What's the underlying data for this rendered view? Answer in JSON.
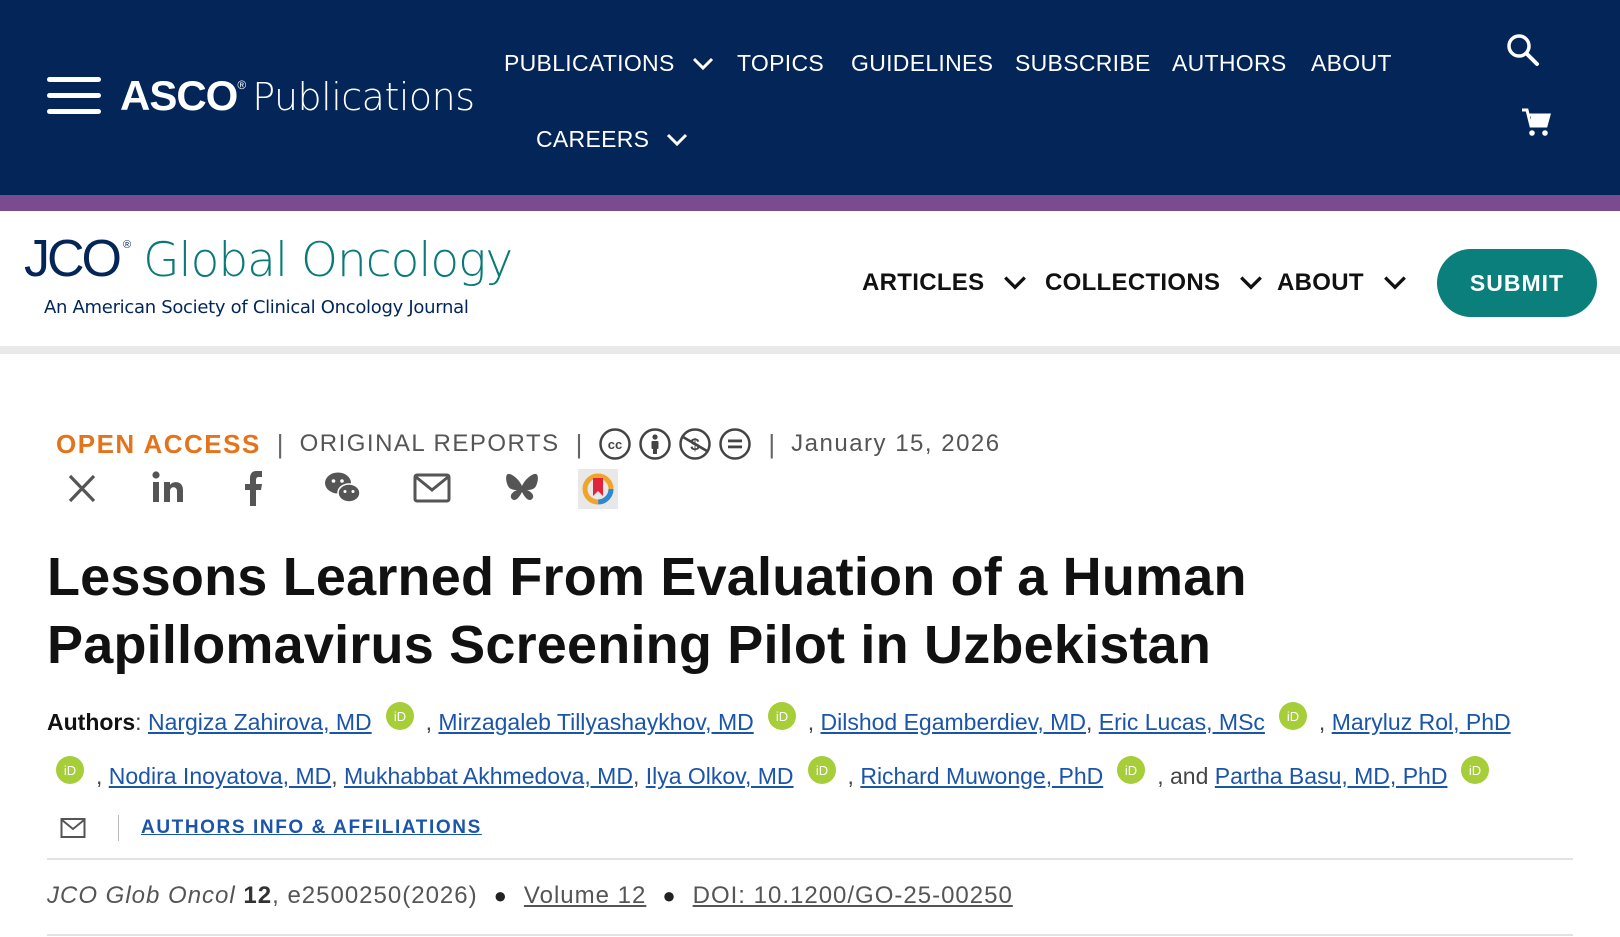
{
  "topbar": {
    "brand_asco": "ASCO",
    "brand_reg": "®",
    "brand_publications": "Publications",
    "nav": [
      "PUBLICATIONS",
      "TOPICS",
      "GUIDELINES",
      "SUBSCRIBE",
      "AUTHORS",
      "ABOUT",
      "CAREERS"
    ],
    "icons": [
      "menu-icon",
      "search-icon",
      "cart-icon",
      "chevron-down-icon"
    ]
  },
  "journal_header": {
    "logo_jco": "JCO",
    "logo_reg": "®",
    "logo_name": "Global Oncology",
    "subtitle": "An American Society of Clinical Oncology Journal",
    "nav": [
      "ARTICLES",
      "COLLECTIONS",
      "ABOUT"
    ],
    "submit_label": "SUBMIT"
  },
  "article": {
    "access": "OPEN ACCESS",
    "separator": "|",
    "section": "ORIGINAL REPORTS",
    "date": "January 15, 2026",
    "license_icons": [
      "cc-icon",
      "by-icon",
      "nc-icon",
      "nd-icon"
    ],
    "share_icons": [
      "x-icon",
      "linkedin-icon",
      "facebook-icon",
      "wechat-icon",
      "email-icon",
      "bluesky-icon",
      "mendeley-icon"
    ],
    "title": "Lessons Learned From Evaluation of a Human Papillomavirus Screening Pilot in Uzbekistan",
    "authors_label": "Authors",
    "authors": [
      "Nargiza Zahirova, MD",
      "Mirzagaleb Tillyashaykhov, MD",
      "Dilshod Egamberdiev, MD",
      "Eric Lucas, MSc",
      "Maryluz Rol, PhD",
      "Nodira Inoyatova, MD",
      "Mukhabbat Akhmedova, MD",
      "Ilya Olkov, MD",
      "Richard Muwonge, PhD",
      "Partha Basu, MD, PhD"
    ],
    "authors_and": "and",
    "affiliations_label": "AUTHORS INFO & AFFILIATIONS",
    "citation": {
      "journal": "JCO Glob Oncol",
      "volume_num": "12",
      "article_id": ", e2500250(2026)",
      "volume_link": "Volume 12",
      "doi": "DOI: 10.1200/GO-25-00250"
    }
  },
  "colors": {
    "top_bar": "#032558",
    "purple_strip": "#7a4b8e",
    "teal": "#0a7f7c",
    "open_access_orange": "#e4731c",
    "link_blue": "#1b55a9",
    "orcid_green": "#a6ce39"
  }
}
